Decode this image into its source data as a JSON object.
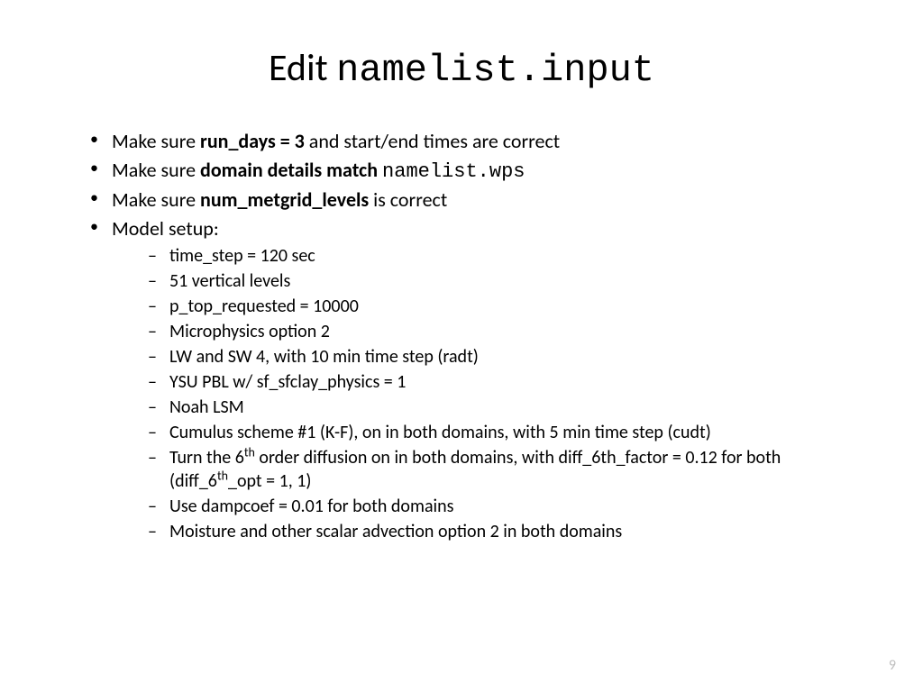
{
  "title": {
    "edit": "Edit ",
    "mono": "namelist.input"
  },
  "bullets": {
    "b1": {
      "pre": "Make sure ",
      "bold": "run_days = 3",
      "post": " and start/end times are correct"
    },
    "b2": {
      "pre": "Make sure ",
      "bold": "domain details match ",
      "mono": "namelist.wps"
    },
    "b3": {
      "pre": "Make sure ",
      "bold": "num_metgrid_levels",
      "post": " is correct"
    },
    "b4": {
      "text": "Model setup:"
    }
  },
  "sub": {
    "s1": "time_step = 120 sec",
    "s2": "51 vertical levels",
    "s3": "p_top_requested = 10000",
    "s4": "Microphysics option 2",
    "s5": "LW and SW 4, with 10 min time step (radt)",
    "s6": "YSU PBL w/ sf_sfclay_physics = 1",
    "s7": "Noah LSM",
    "s8": "Cumulus scheme #1 (K-F), on in both domains, with 5 min time step (cudt)",
    "s9a": "Turn the 6",
    "s9b": "th",
    "s9c": " order diffusion on in both domains, with diff_6th_factor = 0.12 for both (diff_6",
    "s9d": "th",
    "s9e": "_opt = 1, 1)",
    "s10": "Use dampcoef = 0.01 for both domains",
    "s11": "Moisture and other scalar advection option 2 in both domains"
  },
  "pageNumber": "9"
}
